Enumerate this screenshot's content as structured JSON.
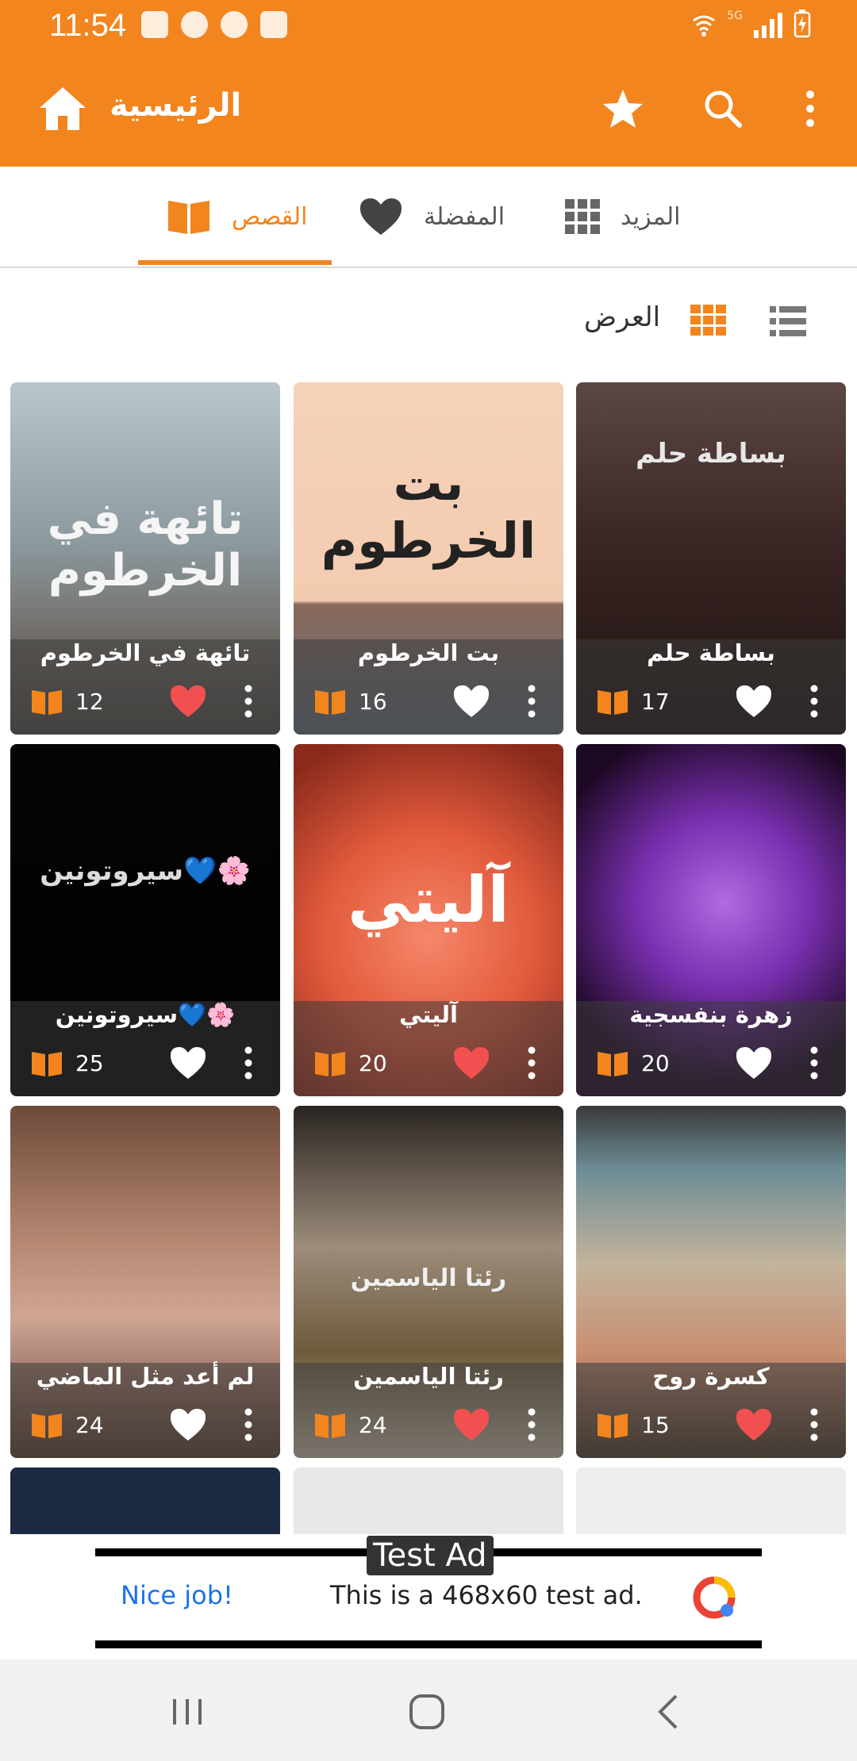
{
  "status": {
    "time": "11:54"
  },
  "toolbar": {
    "title": "الرئيسية"
  },
  "tabs": [
    {
      "label": "القصص",
      "icon": "book-icon",
      "active": true
    },
    {
      "label": "المفضلة",
      "icon": "heart-icon",
      "active": false
    },
    {
      "label": "المزيد",
      "icon": "grid-icon",
      "active": false
    }
  ],
  "view": {
    "label": "العرض"
  },
  "cards": [
    {
      "title": "بساطة حلم",
      "count": "17",
      "favorite": false,
      "cover_text": "بساطة حلم"
    },
    {
      "title": "بت الخرطوم",
      "count": "16",
      "favorite": false,
      "cover_text": "بت الخرطوم"
    },
    {
      "title": "تائهة في الخرطوم",
      "count": "12",
      "favorite": true,
      "cover_text": "تائهة في الخرطوم"
    },
    {
      "title": "زهرة بنفسجية",
      "count": "20",
      "favorite": false,
      "cover_text": ""
    },
    {
      "title": "آليتي",
      "count": "20",
      "favorite": true,
      "cover_text": "آليتي"
    },
    {
      "title": "سيروتونين💙🌸",
      "count": "25",
      "favorite": false,
      "cover_text": "سيروتونين💙🌸"
    },
    {
      "title": "كسرة روح",
      "count": "15",
      "favorite": true,
      "cover_text": ""
    },
    {
      "title": "رئتا الياسمين",
      "count": "24",
      "favorite": true,
      "cover_text": "رئتا الياسمين"
    },
    {
      "title": "لم أعد مثل الماضي",
      "count": "24",
      "favorite": false,
      "cover_text": ""
    }
  ],
  "ad": {
    "label": "Test Ad",
    "cta": "Nice job!",
    "text": "This is a 468x60 test ad."
  },
  "colors": {
    "accent": "#f2851e",
    "heart_active": "#f25050",
    "heart_inactive": "#ffffff"
  }
}
